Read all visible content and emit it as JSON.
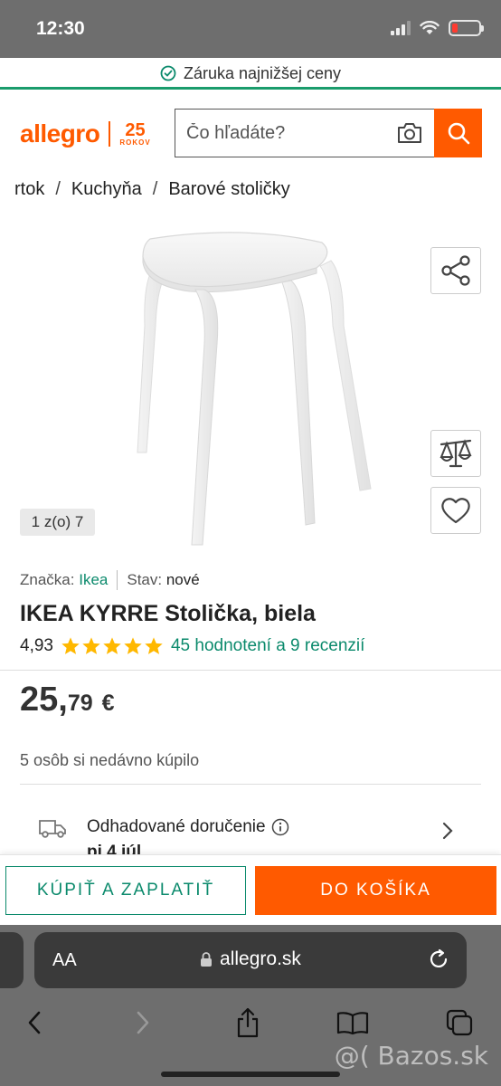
{
  "status_bar": {
    "time": "12:30"
  },
  "guarantee": {
    "text": "Záruka najnižšej ceny"
  },
  "header": {
    "logo": "allegro",
    "anniversary_number": "25",
    "anniversary_label": "ROKOV",
    "search_placeholder": "Čo hľadáte?"
  },
  "breadcrumb": [
    "rtok",
    "Kuchyňa",
    "Barové stoličky"
  ],
  "gallery": {
    "counter": "1 z(o) 7"
  },
  "product": {
    "brand_label": "Značka:",
    "brand": "Ikea",
    "condition_label": "Stav:",
    "condition": "nové",
    "title": "IKEA KYRRE Stolička, biela",
    "rating": "4,93",
    "stars": 5,
    "rating_link": "45 hodnotení a 9 recenzií",
    "price_int": "25,",
    "price_dec": "79",
    "currency": "€",
    "recent_buyers": "5 osôb si nedávno kúpilo",
    "delivery_label": "Odhadované doručenie",
    "delivery_date": "pi 4 júl"
  },
  "actions": {
    "buy_now": "KÚPIŤ A ZAPLATIŤ",
    "add_to_cart": "DO KOŠÍKA"
  },
  "browser": {
    "text_size": "AA",
    "url": "allegro.sk",
    "watermark": "@( Bazos.sk"
  },
  "colors": {
    "brand": "#ff5a00",
    "accent_green": "#0b8a6c",
    "star": "#ffb800"
  }
}
